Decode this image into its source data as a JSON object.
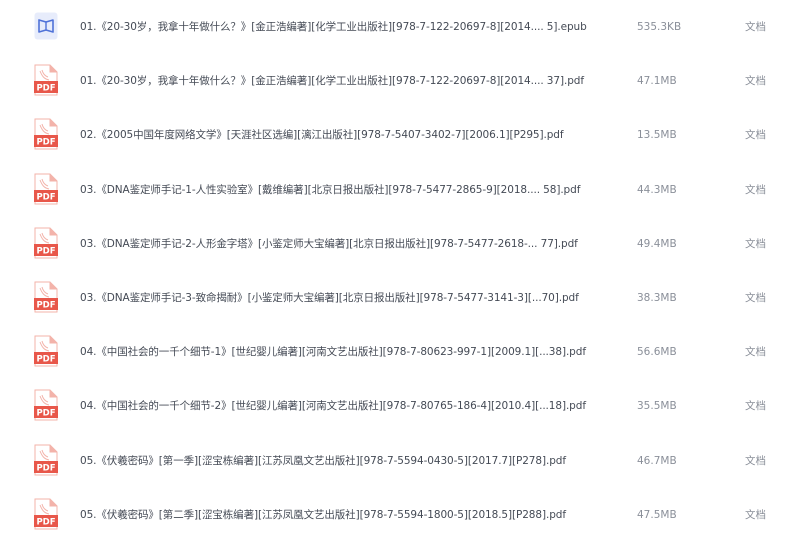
{
  "colors": {
    "pdf_icon_red": "#e8574a",
    "pdf_icon_light": "#f3b3aa",
    "epub_icon_blue": "#4f72d8",
    "epub_icon_light": "#e7ecfb",
    "name_text": "#444a55",
    "meta_text": "#8a8f99"
  },
  "files": [
    {
      "icon": "epub-book-icon",
      "name": "01.《20-30岁，我拿十年做什么？》[金正浩编著][化学工业出版社][978-7-122-20697-8][2014.... 5].epub",
      "size": "535.3KB",
      "type": "文档"
    },
    {
      "icon": "pdf-file-icon",
      "icon_label": "PDF",
      "name": "01.《20-30岁，我拿十年做什么？》[金正浩编著][化学工业出版社][978-7-122-20697-8][2014.... 37].pdf",
      "size": "47.1MB",
      "type": "文档"
    },
    {
      "icon": "pdf-file-icon",
      "icon_label": "PDF",
      "name": "02.《2005中国年度网络文学》[天涯社区选编][漓江出版社][978-7-5407-3402-7][2006.1][P295].pdf",
      "size": "13.5MB",
      "type": "文档"
    },
    {
      "icon": "pdf-file-icon",
      "icon_label": "PDF",
      "name": "03.《DNA鉴定师手记-1-人性实验室》[戴维编著][北京日报出版社][978-7-5477-2865-9][2018.... 58].pdf",
      "size": "44.3MB",
      "type": "文档"
    },
    {
      "icon": "pdf-file-icon",
      "icon_label": "PDF",
      "name": "03.《DNA鉴定师手记-2-人形金字塔》[小鉴定师大宝编著][北京日报出版社][978-7-5477-2618-... 77].pdf",
      "size": "49.4MB",
      "type": "文档"
    },
    {
      "icon": "pdf-file-icon",
      "icon_label": "PDF",
      "name": "03.《DNA鉴定师手记-3-致命揭耐》[小鉴定师大宝编著][北京日报出版社][978-7-5477-3141-3][...70].pdf",
      "size": "38.3MB",
      "type": "文档"
    },
    {
      "icon": "pdf-file-icon",
      "icon_label": "PDF",
      "name": "04.《中国社会的一千个细节-1》[世纪婴儿编著][河南文艺出版社][978-7-80623-997-1][2009.1][...38].pdf",
      "size": "56.6MB",
      "type": "文档"
    },
    {
      "icon": "pdf-file-icon",
      "icon_label": "PDF",
      "name": "04.《中国社会的一千个细节-2》[世纪婴儿编著][河南文艺出版社][978-7-80765-186-4][2010.4][...18].pdf",
      "size": "35.5MB",
      "type": "文档"
    },
    {
      "icon": "pdf-file-icon",
      "icon_label": "PDF",
      "name": "05.《伏羲密码》[第一季][涩宝栋编著][江苏凤凰文艺出版社][978-7-5594-0430-5][2017.7][P278].pdf",
      "size": "46.7MB",
      "type": "文档"
    },
    {
      "icon": "pdf-file-icon",
      "icon_label": "PDF",
      "name": "05.《伏羲密码》[第二季][涩宝栋编著][江苏凤凰文艺出版社][978-7-5594-1800-5][2018.5][P288].pdf",
      "size": "47.5MB",
      "type": "文档"
    }
  ]
}
